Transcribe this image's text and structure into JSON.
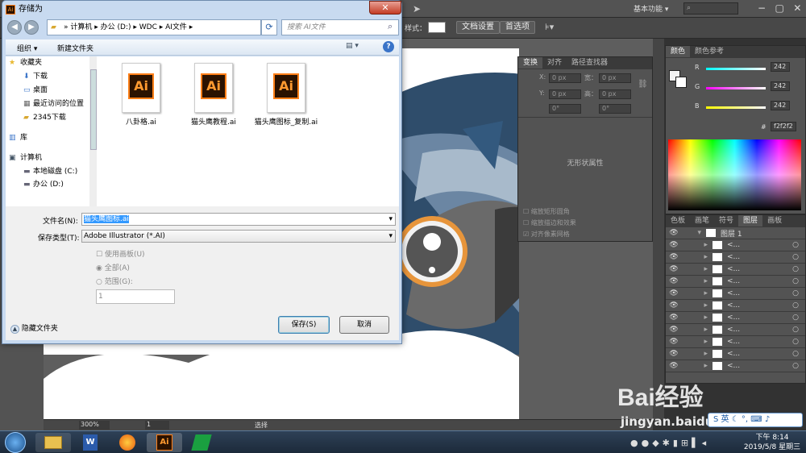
{
  "illustrator": {
    "workspace_label": "基本功能",
    "ctrl_style_label": "样式：",
    "doc_settings_label": "文档设置",
    "prefs_label": "首选项",
    "transform_tabs": [
      "变换",
      "对齐",
      "路径查找器"
    ],
    "fields": {
      "x": "0 px",
      "y": "0 px",
      "w": "0 px",
      "h": "0 px",
      "angle": "0°",
      "shear": "0°"
    },
    "field_labels": {
      "x": "X:",
      "y": "Y:",
      "w": "宽：",
      "h": "高："
    },
    "no_shape_props": "无形状属性",
    "checkboxes": [
      "缩放矩形圆角",
      "缩放描边和效果",
      "对齐像素网格"
    ],
    "color_tabs": [
      "颜色",
      "颜色参考"
    ],
    "color": {
      "r_label": "R",
      "g_label": "G",
      "b_label": "B",
      "r": "242",
      "g": "242",
      "b": "242",
      "hex": "f2f2f2",
      "hex_prefix": "#"
    },
    "layer_tabs": [
      "色板",
      "画笔",
      "符号",
      "图层",
      "画板"
    ],
    "layer_top": "图层 1",
    "layer_count_rows": 11,
    "layer_row_label": "<...",
    "zoom": "300%",
    "page_no": "1",
    "status_tool": "选择"
  },
  "dialog": {
    "title": "存储为",
    "breadcrumb": [
      "计算机",
      "办公 (D:)",
      "WDC",
      "AI文件"
    ],
    "search_placeholder": "搜索 AI文件",
    "organize": "组织",
    "new_folder": "新建文件夹",
    "nav": [
      "收藏夹",
      "下载",
      "桌面",
      "最近访问的位置",
      "2345下载",
      "库",
      "计算机",
      "本地磁盘 (C:)",
      "办公 (D:)"
    ],
    "files": [
      "八卦格.ai",
      "猫头鹰教程.ai",
      "猫头鹰图标_复制.ai"
    ],
    "file_badge": "Ai",
    "filename_label": "文件名(N):",
    "filename_value": "猫头鹰图标.ai",
    "filetype_label": "保存类型(T):",
    "filetype_value": "Adobe Illustrator (*.AI)",
    "use_artboards": "使用画板(U)",
    "all_label": "全部(A)",
    "range_label": "范围(G):",
    "range_value": "1",
    "hide_folders": "隐藏文件夹",
    "save": "保存(S)",
    "cancel": "取消"
  },
  "taskbar": {
    "ime": "英",
    "time": "下午 8:14",
    "date": "2019/5/8 星期三"
  },
  "watermark": {
    "brand": "Bai经验",
    "url": "jingyan.baidu.com"
  }
}
